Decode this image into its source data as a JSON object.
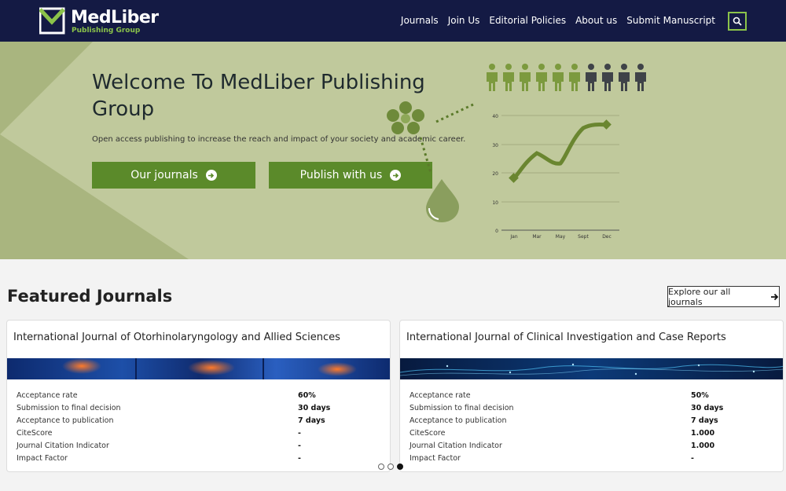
{
  "header": {
    "logo_title": "MedLiber",
    "logo_subtitle": "Publishing Group",
    "nav": [
      "Journals",
      "Join Us",
      "Editorial Policies",
      "About us",
      "Submit Manuscript"
    ],
    "search_icon": "search-icon"
  },
  "hero": {
    "title": "Welcome To MedLiber Publishing Group",
    "subtitle": "Open access publishing to increase the reach and impact of your society and academic career.",
    "btn_journals": "Our journals",
    "btn_publish": "Publish with us"
  },
  "hero_chart": {
    "y_ticks": [
      "40",
      "30",
      "20",
      "10",
      "0"
    ],
    "x_ticks": [
      "Jan",
      "Mar",
      "May",
      "Sept",
      "Dec"
    ]
  },
  "featured": {
    "title": "Featured Journals",
    "explore_label": "Explore our all journals"
  },
  "cards": [
    {
      "title": "International Journal of Otorhinolaryngology and Allied Sciences",
      "stats": [
        {
          "label": "Acceptance rate",
          "value": "60%"
        },
        {
          "label": "Submission to final decision",
          "value": "30 days"
        },
        {
          "label": "Acceptance to publication",
          "value": "7 days"
        },
        {
          "label": "CiteScore",
          "value": "-"
        },
        {
          "label": "Journal Citation Indicator",
          "value": "-"
        },
        {
          "label": "Impact Factor",
          "value": "-"
        }
      ]
    },
    {
      "title": "International Journal of Clinical Investigation and Case Reports",
      "stats": [
        {
          "label": "Acceptance rate",
          "value": "50%"
        },
        {
          "label": "Submission to final decision",
          "value": "30 days"
        },
        {
          "label": "Acceptance to publication",
          "value": "7 days"
        },
        {
          "label": "CiteScore",
          "value": "1.000"
        },
        {
          "label": "Journal Citation Indicator",
          "value": "1.000"
        },
        {
          "label": "Impact Factor",
          "value": "-"
        }
      ]
    }
  ],
  "carousel": {
    "active_index": 2,
    "count": 3
  },
  "colors": {
    "navy": "#141a44",
    "green": "#5b8a2a",
    "hero_bg": "#c0c99c",
    "accent": "#8bc34a"
  }
}
